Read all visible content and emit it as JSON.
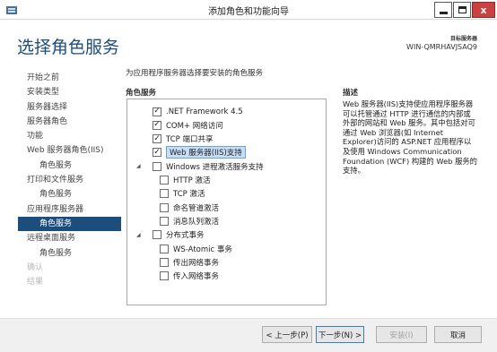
{
  "window": {
    "title": "添加角色和功能向导",
    "close_glyph": "x"
  },
  "header": {
    "title": "选择角色服务",
    "server_label": "目标服务器",
    "server_name": "WIN-QMRHAVJSAQ9"
  },
  "nav": {
    "items": [
      {
        "label": "开始之前",
        "state": "normal",
        "sub": false
      },
      {
        "label": "安装类型",
        "state": "normal",
        "sub": false
      },
      {
        "label": "服务器选择",
        "state": "normal",
        "sub": false
      },
      {
        "label": "服务器角色",
        "state": "normal",
        "sub": false
      },
      {
        "label": "功能",
        "state": "normal",
        "sub": false
      },
      {
        "label": "Web 服务器角色(IIS)",
        "state": "normal",
        "sub": false
      },
      {
        "label": "角色服务",
        "state": "normal",
        "sub": true
      },
      {
        "label": "打印和文件服务",
        "state": "normal",
        "sub": false
      },
      {
        "label": "角色服务",
        "state": "normal",
        "sub": true
      },
      {
        "label": "应用程序服务器",
        "state": "normal",
        "sub": false
      },
      {
        "label": "角色服务",
        "state": "active",
        "sub": true
      },
      {
        "label": "远程桌面服务",
        "state": "normal",
        "sub": false
      },
      {
        "label": "角色服务",
        "state": "normal",
        "sub": true
      },
      {
        "label": "确认",
        "state": "disabled",
        "sub": false
      },
      {
        "label": "结果",
        "state": "disabled",
        "sub": false
      }
    ]
  },
  "content": {
    "intro": "为应用程序服务器选择要安装的角色服务",
    "roles_label": "角色服务",
    "description_label": "描述",
    "description": "Web 服务器(IIS)支持使应用程序服务器可以托管通过 HTTP 进行通信的内部或外部的网站和 Web 服务。其中包括对可通过 Web 浏览器(如 Internet Explorer)访问的 ASP.NET 应用程序以及使用 Windows Communication Foundation (WCF) 构建的 Web 服务的支持。",
    "roles": [
      {
        "label": ".NET Framework 4.5",
        "checked": true,
        "level": 0,
        "expander": "",
        "selected": false
      },
      {
        "label": "COM+ 网络访问",
        "checked": true,
        "level": 0,
        "expander": "",
        "selected": false
      },
      {
        "label": "TCP 端口共享",
        "checked": true,
        "level": 0,
        "expander": "",
        "selected": false
      },
      {
        "label": "Web 服务器(IIS)支持",
        "checked": true,
        "level": 0,
        "expander": "",
        "selected": true
      },
      {
        "label": "Windows 进程激活服务支持",
        "checked": false,
        "level": 0,
        "expander": "◢",
        "selected": false
      },
      {
        "label": "HTTP 激活",
        "checked": false,
        "level": 1,
        "expander": "",
        "selected": false
      },
      {
        "label": "TCP 激活",
        "checked": false,
        "level": 1,
        "expander": "",
        "selected": false
      },
      {
        "label": "命名管道激活",
        "checked": false,
        "level": 1,
        "expander": "",
        "selected": false
      },
      {
        "label": "消息队列激活",
        "checked": false,
        "level": 1,
        "expander": "",
        "selected": false
      },
      {
        "label": "分布式事务",
        "checked": false,
        "level": 0,
        "expander": "◢",
        "selected": false
      },
      {
        "label": "WS-Atomic 事务",
        "checked": false,
        "level": 1,
        "expander": "",
        "selected": false
      },
      {
        "label": "传出网络事务",
        "checked": false,
        "level": 1,
        "expander": "",
        "selected": false
      },
      {
        "label": "传入网络事务",
        "checked": false,
        "level": 1,
        "expander": "",
        "selected": false
      }
    ]
  },
  "footer": {
    "prev": "< 上一步(P)",
    "next": "下一步(N) >",
    "install": "安装(I)",
    "cancel": "取消"
  },
  "colors": {
    "accent": "#1c4d7c",
    "selection": "#c5def5"
  }
}
